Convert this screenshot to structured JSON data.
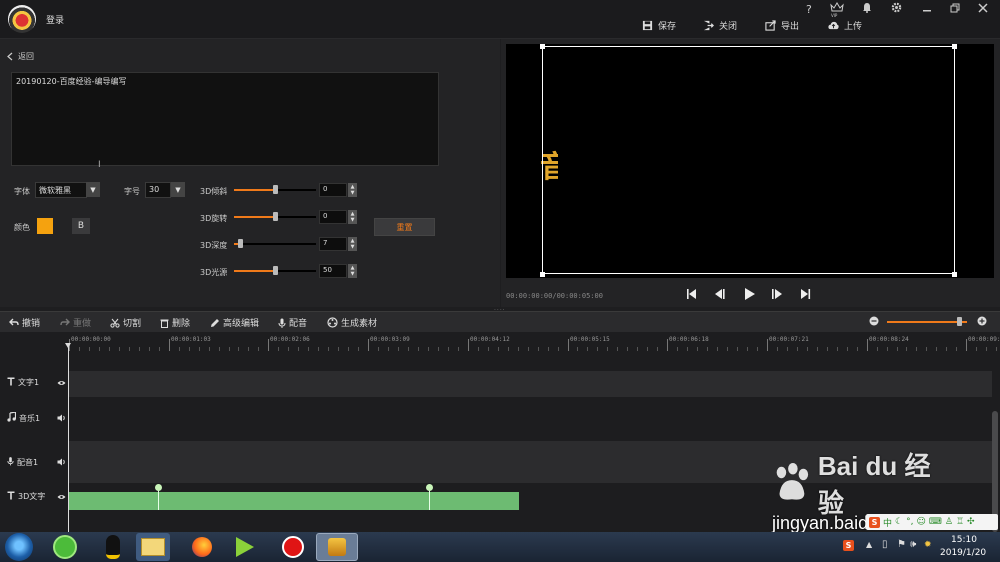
{
  "topbar": {
    "login_label": "登录",
    "save_label": "保存",
    "close_label": "关闭",
    "export_label": "导出",
    "upload_label": "上传",
    "help_icon": "?",
    "vip_label": "VIP"
  },
  "left": {
    "back_label": "返回",
    "text_value": "20190120-百度经验-编导编写",
    "font_label": "字体",
    "font_value": "微软雅黑",
    "size_label": "字号",
    "size_value": "30",
    "color_label": "颜色",
    "color_value": "#f5a20f",
    "bold_label": "B",
    "reset_label": "重置",
    "params": [
      {
        "label": "3D倾斜",
        "value": "0",
        "level": 0.5
      },
      {
        "label": "3D旋转",
        "value": "0",
        "level": 0.5
      },
      {
        "label": "3D深度",
        "value": "7",
        "level": 0.07
      },
      {
        "label": "3D光源",
        "value": "50",
        "level": 0.5
      }
    ]
  },
  "preview": {
    "timecode": "00:00:00:00/00:00:05:00",
    "preview_glyph": "音"
  },
  "toolbar": {
    "undo": "撤销",
    "redo": "重做",
    "cut": "切割",
    "delete": "删除",
    "advanced_edit": "高级编辑",
    "dub": "配音",
    "generate": "生成素材",
    "zoom_level": 0.9
  },
  "timeline": {
    "ticks": [
      "00:00:00:00",
      "00:00:01:03",
      "00:00:02:06",
      "00:00:03:09",
      "00:00:04:12",
      "00:00:05:15",
      "00:00:06:18",
      "00:00:07:21",
      "00:00:08:24",
      "00:00:09:"
    ],
    "tracks": [
      {
        "label": "文字1",
        "icon": "text-icon"
      },
      {
        "label": "音乐1",
        "icon": "music-icon"
      },
      {
        "label": "配音1",
        "icon": "mic-icon"
      },
      {
        "label": "3D文字",
        "icon": "text-icon"
      }
    ]
  },
  "taskbar": {
    "time": "15:10",
    "date": "2019/1/20",
    "ime_label": "中"
  },
  "watermark": {
    "brand": "Bai du 经验",
    "url": "jingyan.baidu.com"
  }
}
